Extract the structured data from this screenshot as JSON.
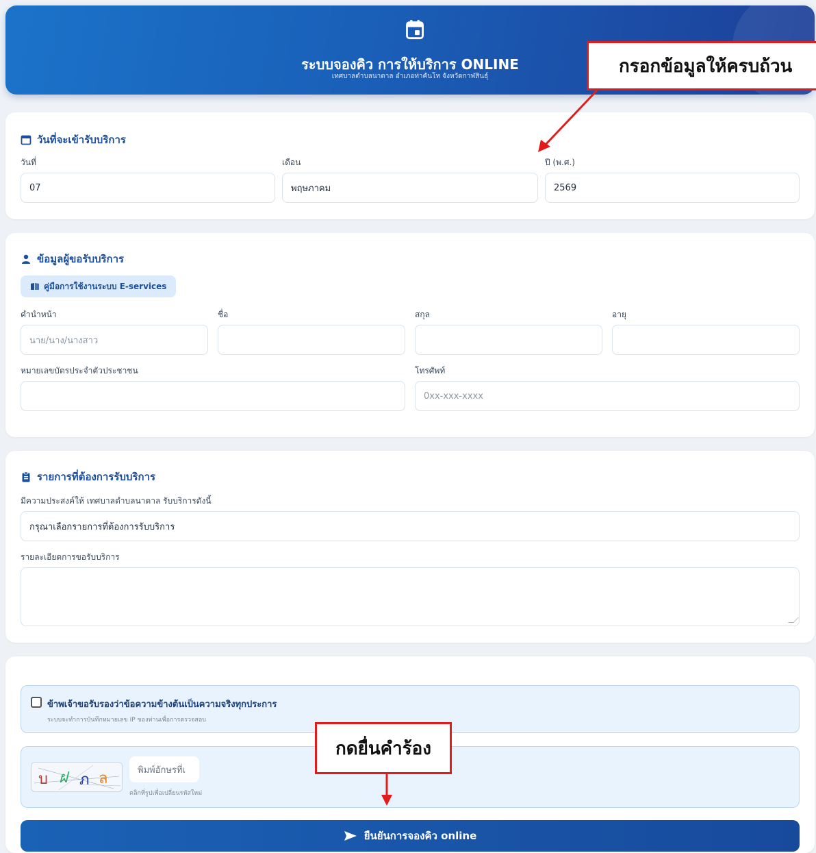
{
  "header": {
    "title": "ระบบจองคิว การให้บริการ ONLINE",
    "subtitle": "เทศบาลตำบลนาตาล อำเภอท่าคันโท จังหวัดกาฬสินธุ์"
  },
  "date_section": {
    "title": "วันที่จะเข้ารับบริการ",
    "day_label": "วันที่",
    "day_value": "07",
    "month_label": "เดือน",
    "month_value": "พฤษภาคม",
    "year_label": "ปี (พ.ศ.)",
    "year_value": "2569"
  },
  "applicant_section": {
    "title": "ข้อมูลผู้ขอรับบริการ",
    "manual_button": "คู่มือการใช้งานระบบ E-services",
    "prefix_label": "คำนำหน้า",
    "prefix_placeholder": "นาย/นาง/นางสาว",
    "first_name_label": "ชื่อ",
    "last_name_label": "สกุล",
    "age_label": "อายุ",
    "id_card_label": "หมายเลขบัตรประจำตัวประชาชน",
    "phone_label": "โทรศัพท์",
    "phone_placeholder": "0xx-xxx-xxxx"
  },
  "service_section": {
    "title": "รายการที่ต้องการรับบริการ",
    "purpose_label": "มีความประสงค์ให้ เทศบาลตำบลนาตาล รับบริการดังนี้",
    "service_select_value": "กรุณาเลือกรายการที่ต้องการรับบริการ",
    "details_label": "รายละเอียดการขอรับบริการ"
  },
  "confirm_section": {
    "consent_text": "ข้าพเจ้าขอรับรองว่าข้อความข้างต้นเป็นความจริงทุกประการ",
    "consent_note": "ระบบจะทำการบันทึกหมายเลข IP ของท่านเพื่อการตรวจสอบ",
    "captcha_chars": [
      "บ",
      "ฝ",
      "ภ",
      "ล"
    ],
    "captcha_placeholder": "พิมพ์อักษรที่เ",
    "captcha_hint": "คลิกที่รูปเพื่อเปลี่ยนรหัสใหม่",
    "submit_label": "ยืนยันการจองคิว online"
  },
  "annotations": {
    "fill_all": "กรอกข้อมูลให้ครบถ้วน",
    "submit_request": "กดยื่นคำร้อง",
    "color": "#e21b1b"
  },
  "colors": {
    "primary": "#1a62b6",
    "section_title": "#1b4f9c",
    "light_panel": "#e8f3fd"
  }
}
